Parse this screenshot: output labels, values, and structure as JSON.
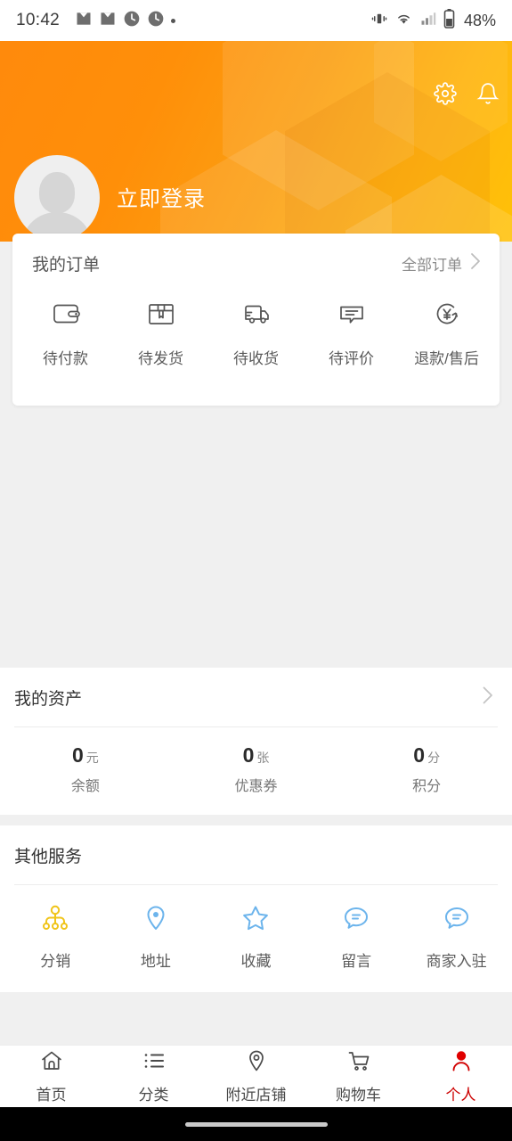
{
  "status_bar": {
    "time": "10:42",
    "battery_text": "48%",
    "icons": [
      "mail-icon",
      "mail-icon",
      "clock-icon",
      "clock-icon",
      "dot-icon"
    ],
    "right_icons": [
      "vibrate-icon",
      "wifi-icon",
      "signal-icon",
      "battery-icon"
    ]
  },
  "header": {
    "login_label": "立即登录",
    "settings_icon": "gear-icon",
    "notification_icon": "bell-icon",
    "avatar_icon": "avatar-placeholder",
    "background_color": "#ff9500",
    "gradient_end_color": "#ffc107"
  },
  "orders": {
    "title": "我的订单",
    "all_orders_label": "全部订单",
    "chevron_icon": "chevron-right-icon",
    "items": [
      {
        "label": "待付款",
        "icon": "wallet-icon"
      },
      {
        "label": "待发货",
        "icon": "box-icon"
      },
      {
        "label": "待收货",
        "icon": "truck-icon"
      },
      {
        "label": "待评价",
        "icon": "comment-icon"
      },
      {
        "label": "退款/售后",
        "icon": "refund-icon"
      }
    ]
  },
  "assets": {
    "title": "我的资产",
    "chevron_icon": "chevron-right-icon",
    "stats": [
      {
        "value": "0",
        "unit": "元",
        "label": "余额"
      },
      {
        "value": "0",
        "unit": "张",
        "label": "优惠券"
      },
      {
        "value": "0",
        "unit": "分",
        "label": "积分"
      }
    ]
  },
  "other_services": {
    "title": "其他服务",
    "items": [
      {
        "label": "分销",
        "icon": "distribution-tree-icon",
        "color": "#f0c419"
      },
      {
        "label": "地址",
        "icon": "location-pin-icon",
        "color": "#6cb4ec"
      },
      {
        "label": "收藏",
        "icon": "star-icon",
        "color": "#6cb4ec"
      },
      {
        "label": "留言",
        "icon": "chat-bubble-icon",
        "color": "#6cb4ec"
      },
      {
        "label": "商家入驻",
        "icon": "chat-bubble-icon",
        "color": "#6cb4ec"
      }
    ]
  },
  "tabbar": {
    "active_color": "#cc0000",
    "items": [
      {
        "label": "首页",
        "icon": "home-icon",
        "active": false
      },
      {
        "label": "分类",
        "icon": "list-icon",
        "active": false
      },
      {
        "label": "附近店铺",
        "icon": "location-icon",
        "active": false
      },
      {
        "label": "购物车",
        "icon": "cart-icon",
        "active": false
      },
      {
        "label": "个人",
        "icon": "person-icon",
        "active": true
      }
    ]
  }
}
